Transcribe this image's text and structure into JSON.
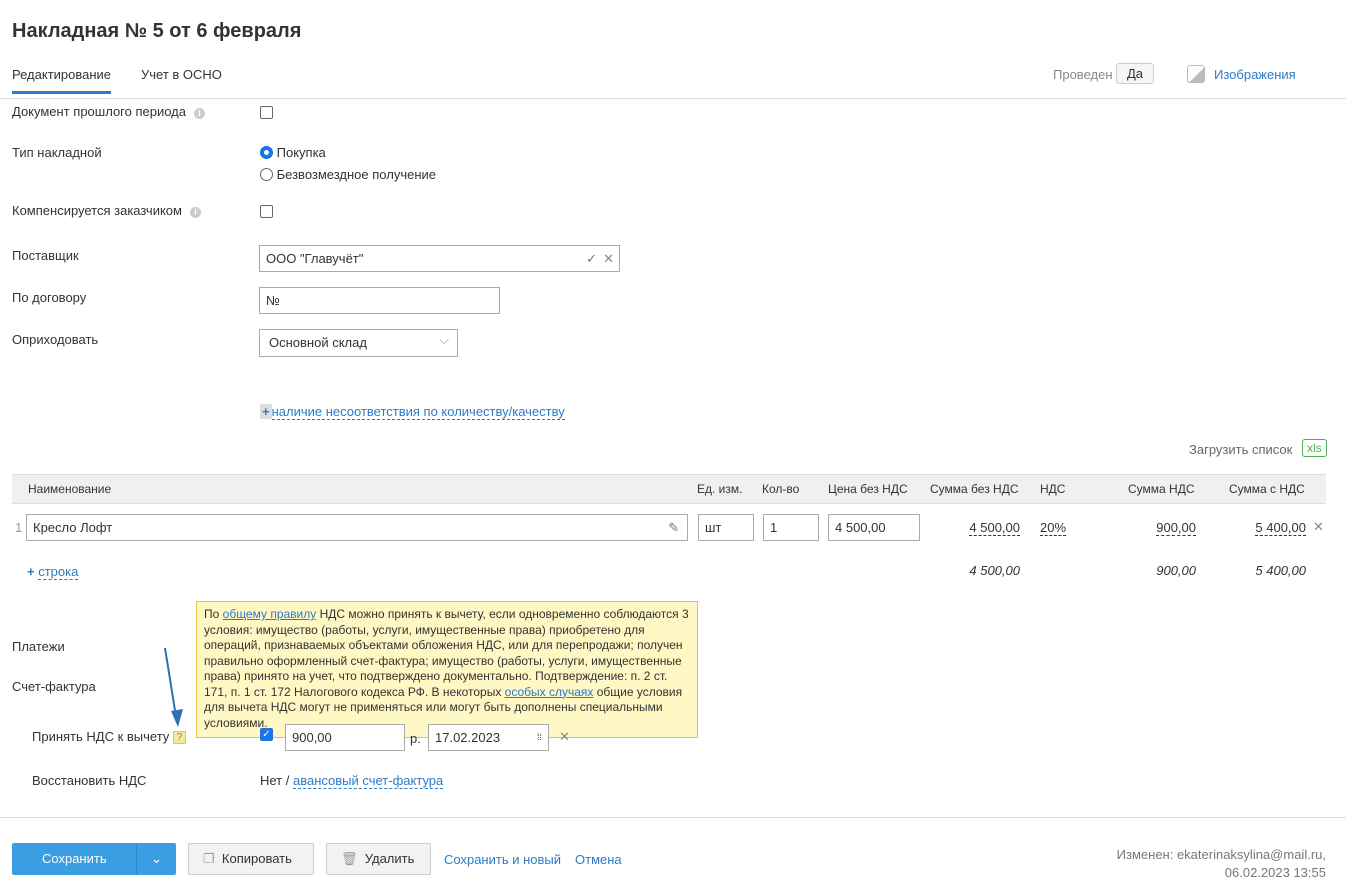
{
  "title": "Накладная № 5 от 6 февраля",
  "tabs": [
    {
      "label": "Редактирование",
      "active": true
    },
    {
      "label": "Учет в ОСНО"
    }
  ],
  "header": {
    "posted_label": "Проведен",
    "posted_value": "Да",
    "images_label": "Изображения"
  },
  "form": {
    "past_period_label": "Документ прошлого периода",
    "type_label": "Тип накладной",
    "type_options": [
      "Покупка",
      "Безвозмездное получение"
    ],
    "type_selected": "Покупка",
    "compensated_label": "Компенсируется заказчиком",
    "supplier_label": "Поставщик",
    "supplier_value": "ООО \"Главучёт\"",
    "contract_label": "По договору",
    "contract_value": "№",
    "warehouse_label": "Оприходовать",
    "warehouse_value": "Основной склад",
    "mismatch_link": "наличие несоответствия по количеству/качеству"
  },
  "upload": {
    "label": "Загрузить список",
    "xls": "xls"
  },
  "table": {
    "headers": [
      "Наименование",
      "Ед. изм.",
      "Кол-во",
      "Цена без НДС",
      "Сумма без НДС",
      "НДС",
      "Сумма НДС",
      "Сумма с НДС"
    ],
    "rows": [
      {
        "n": "1",
        "name": "Кресло Лофт",
        "unit": "шт",
        "qty": "1",
        "price": "4 500,00",
        "sum": "4 500,00",
        "vat": "20%",
        "vat_sum": "900,00",
        "total": "5 400,00"
      }
    ],
    "add_row": "строка",
    "totals": {
      "sum": "4 500,00",
      "vat_sum": "900,00",
      "total": "5 400,00"
    }
  },
  "payments_label": "Платежи",
  "invoice_label": "Счет-фактура",
  "tooltip": {
    "pre": "По ",
    "link1": "общему правилу",
    "mid": " НДС можно принять к вычету, если одновременно соблюдаются 3 условия: имущество (работы, услуги, имущественные права) приобретено для операций, признаваемых объектами обложения НДС, или для перепродажи; получен правильно оформленный счет-фактура; имущество (работы, услуги, имущественные права) принято на учет, что подтверждено документально. Подтверждение: п. 2 ст. 171, п. 1 ст. 172 Налогового кодекса РФ. В некоторых ",
    "link2": "особых случаях",
    "post": " общие условия для вычета НДС могут не применяться или могут быть дополнены специальными условиями."
  },
  "vat_deduct": {
    "label": "Принять НДС к вычету",
    "help": "?",
    "amount": "900,00",
    "currency": "р.",
    "date": "17.02.2023"
  },
  "vat_restore": {
    "label": "Восстановить НДС",
    "value": "Нет",
    "sep": " / ",
    "link": "авансовый счет-фактура"
  },
  "footer": {
    "save": "Сохранить",
    "copy": "Копировать",
    "delete": "Удалить",
    "save_new": "Сохранить и новый",
    "cancel": "Отмена",
    "modified": "Изменен: ekaterinaksylina@mail.ru,",
    "modified_date": "06.02.2023 13:55"
  },
  "colors": {
    "accent": "#2b7bc6",
    "primary_button": "#3a9ee2",
    "tooltip_bg": "#fff7c4",
    "tooltip_border": "#e3c43a"
  }
}
